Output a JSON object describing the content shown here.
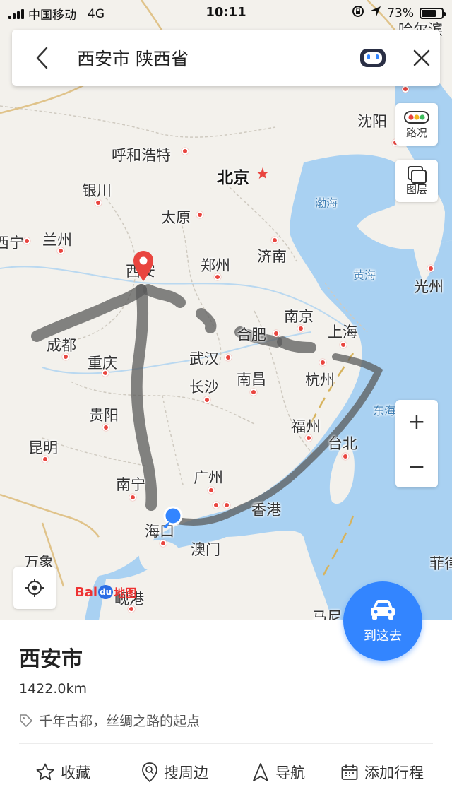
{
  "status_bar": {
    "carrier": "中国移动",
    "network": "4G",
    "time": "10:11",
    "battery": "73%",
    "battery_level": 0.73
  },
  "search": {
    "query": "西安市 陕西省"
  },
  "map": {
    "cities": [
      "呼和浩特",
      "北京",
      "沈阳",
      "银川",
      "太原",
      "兰州",
      "西宁",
      "西安",
      "郑州",
      "济南",
      "成都",
      "南京",
      "合肥",
      "上海",
      "重庆",
      "武汉",
      "杭州",
      "长沙",
      "南昌",
      "贵阳",
      "福州",
      "台北",
      "昆明",
      "南宁",
      "广州",
      "香港",
      "澳门",
      "海口",
      "光州",
      "万象",
      "岘港",
      "马尼拉",
      "哈尔滨",
      "菲律宾"
    ],
    "city_labels": {
      "hohhot": "呼和浩特",
      "beijing": "北京",
      "shenyang": "沈阳",
      "yinchuan": "银川",
      "taiyuan": "太原",
      "lanzhou": "兰州",
      "xining": "西宁",
      "xian": "西安",
      "zhengzhou": "郑州",
      "jinan": "济南",
      "chengdu": "成都",
      "nanjing": "南京",
      "hefei": "合肥",
      "shanghai": "上海",
      "chongqing": "重庆",
      "wuhan": "武汉",
      "hangzhou": "杭州",
      "changsha": "长沙",
      "nanchang": "南昌",
      "guiyang": "贵阳",
      "fuzhou": "福州",
      "taipei": "台北",
      "kunming": "昆明",
      "nanning": "南宁",
      "guangzhou": "广州",
      "hongkong": "香港",
      "macau": "澳门",
      "haikou": "海口",
      "gwangju": "光州",
      "vientiane": "万象",
      "danang": "岘港",
      "manila": "马尼",
      "harbin": "哈尔滨",
      "philippines": "菲律"
    },
    "seas": {
      "bohai": "渤海",
      "yellow": "黄海",
      "east": "东海"
    },
    "colors": {
      "land": "#f3f1ec",
      "sea": "#a9d1f2",
      "route": "#5b5b5b",
      "marker": "#e9453f",
      "current": "#3385ff"
    }
  },
  "controls": {
    "traffic": "路况",
    "layers": "图层",
    "zoom_in": "+",
    "zoom_out": "−",
    "go": "到这去"
  },
  "place": {
    "name": "西安市",
    "distance": "1422.0km",
    "tagline": "千年古都，丝绸之路的起点"
  },
  "actions": {
    "favorite": "收藏",
    "nearby": "搜周边",
    "navigate": "导航",
    "add_trip": "添加行程"
  },
  "logo": {
    "text1": "Bai",
    "text2": "du",
    "text3": "地图"
  }
}
